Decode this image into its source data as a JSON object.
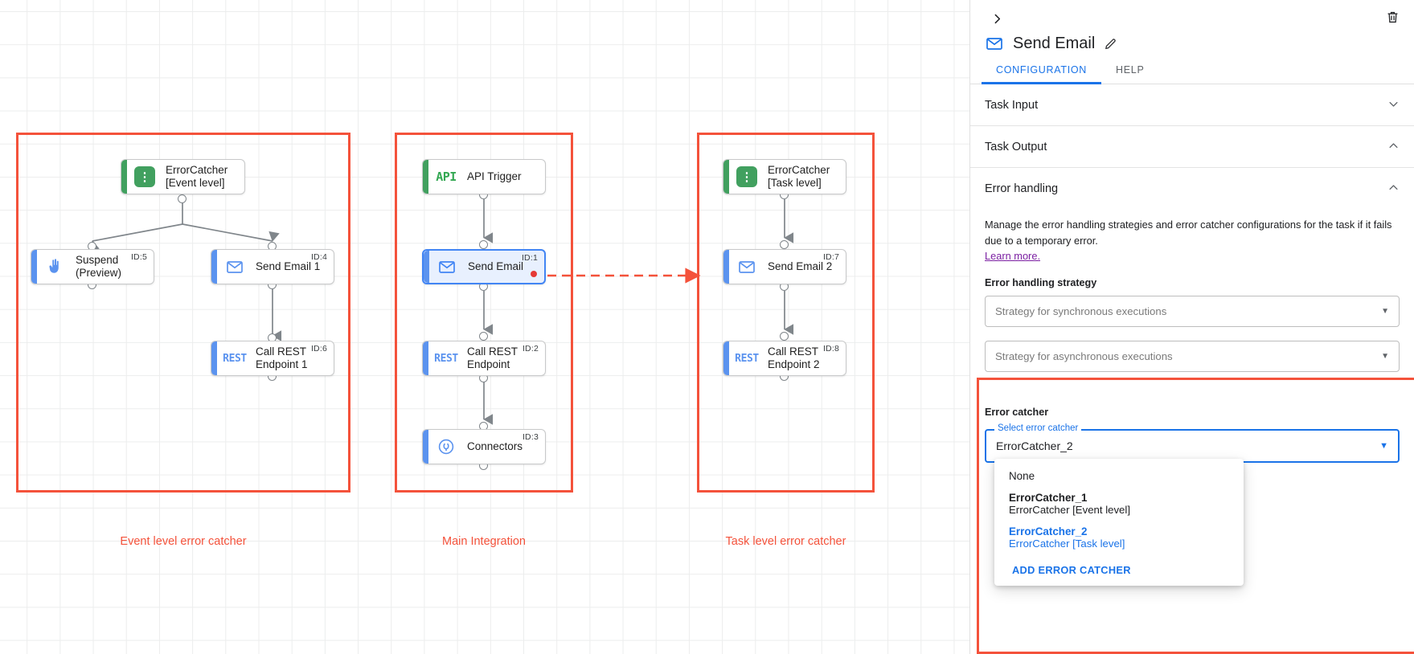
{
  "canvas": {
    "groups": [
      {
        "caption": "Event level error catcher"
      },
      {
        "caption": "Main Integration"
      },
      {
        "caption": "Task level error catcher"
      }
    ],
    "nodes": {
      "error_catcher_event": {
        "label": "ErrorCatcher\n[Event level]",
        "icon": "error-catcher-icon",
        "id": ""
      },
      "suspend": {
        "label": "Suspend\n(Preview)",
        "icon": "hand-icon",
        "id": "ID:5"
      },
      "send_email_1": {
        "label": "Send Email 1",
        "icon": "envelope-icon",
        "id": "ID:4"
      },
      "call_rest_1": {
        "label": "Call REST\nEndpoint 1",
        "icon": "rest-icon",
        "id": "ID:6"
      },
      "api_trigger": {
        "label": "API Trigger",
        "icon": "api-icon",
        "id": ""
      },
      "send_email": {
        "label": "Send Email",
        "icon": "envelope-icon",
        "id": "ID:1"
      },
      "call_rest": {
        "label": "Call REST\nEndpoint",
        "icon": "rest-icon",
        "id": "ID:2"
      },
      "connectors": {
        "label": "Connectors",
        "icon": "connectors-icon",
        "id": "ID:3"
      },
      "error_catcher_task": {
        "label": "ErrorCatcher\n[Task level]",
        "icon": "error-catcher-icon",
        "id": ""
      },
      "send_email_2": {
        "label": "Send Email 2",
        "icon": "envelope-icon",
        "id": "ID:7"
      },
      "call_rest_2": {
        "label": "Call REST\nEndpoint 2",
        "icon": "rest-icon",
        "id": "ID:8"
      }
    }
  },
  "panel": {
    "collapse_icon": "chevron-right-icon",
    "delete_icon": "trash-icon",
    "title": "Send Email",
    "title_icon": "envelope-icon",
    "edit_icon": "pencil-icon",
    "tabs": [
      {
        "label": "CONFIGURATION",
        "active": true
      },
      {
        "label": "HELP",
        "active": false
      }
    ],
    "sections": [
      {
        "title": "Task Input",
        "expanded": false,
        "caret": "chevron-down-icon"
      },
      {
        "title": "Task Output",
        "expanded": true,
        "caret": "chevron-up-icon"
      },
      {
        "title": "Error handling",
        "expanded": true,
        "caret": "chevron-up-icon"
      }
    ],
    "error_handling": {
      "description": "Manage the error handling strategies and error catcher configurations for the task if it fails due to a temporary error.",
      "learn_more": "Learn more.",
      "strategy_label": "Error handling strategy",
      "sync_placeholder": "Strategy for synchronous executions",
      "async_placeholder": "Strategy for asynchronous executions"
    },
    "error_catcher": {
      "title": "Error catcher",
      "float_label": "Select error catcher",
      "value": "ErrorCatcher_2",
      "options": [
        {
          "primary": "None",
          "secondary": "",
          "selected": false,
          "bold": false
        },
        {
          "primary": "ErrorCatcher_1",
          "secondary": "ErrorCatcher [Event level]",
          "selected": false,
          "bold": true
        },
        {
          "primary": "ErrorCatcher_2",
          "secondary": "ErrorCatcher [Task level]",
          "selected": true,
          "bold": true
        }
      ],
      "add_label": "ADD ERROR CATCHER"
    }
  },
  "colors": {
    "accent_blue": "#1a73e8",
    "highlight_red": "#f4523b",
    "green": "#41a05f",
    "node_blue": "#5b93ef",
    "link_purple": "#7b1fa2"
  }
}
